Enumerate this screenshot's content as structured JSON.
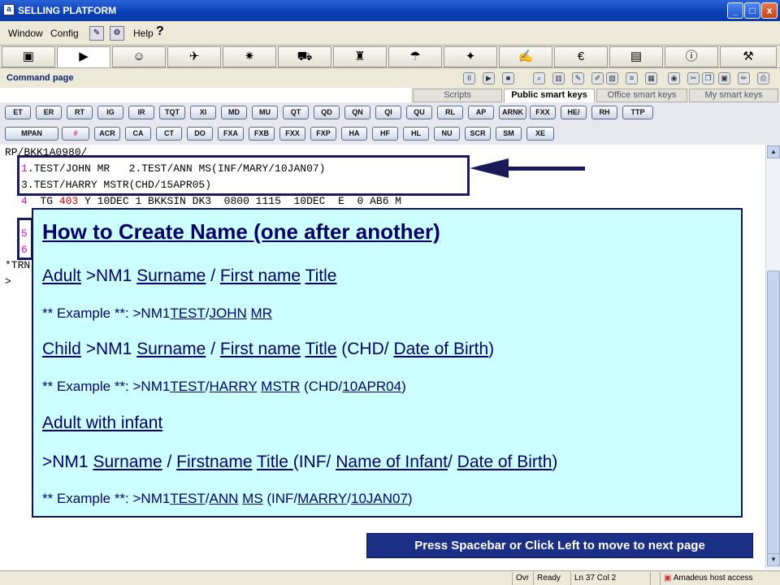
{
  "window": {
    "title": "SELLING PLATFORM",
    "min_label": "_",
    "max_label": "□",
    "close_label": "x"
  },
  "menu": {
    "window": "Window",
    "config": "Config",
    "help": "Help",
    "help_mark": "?"
  },
  "app_icons": [
    "home-icon",
    "terminal-icon",
    "agent-icon",
    "plane-icon",
    "plane-services-icon",
    "car-icon",
    "hotel-icon",
    "insurance-icon",
    "ticket-icon",
    "edit-icon",
    "money-icon",
    "docs-icon",
    "info-icon",
    "tools-icon"
  ],
  "command": {
    "page_label": "Command page"
  },
  "tabs": {
    "scripts": "Scripts",
    "public": "Public smart keys",
    "office": "Office smart keys",
    "my": "My smart keys"
  },
  "keys_row1": [
    "ET",
    "ER",
    "RT",
    "IG",
    "IR",
    "TQT",
    "XI",
    "MD",
    "MU",
    "QT",
    "QD",
    "QN",
    "QI",
    "QU",
    "RL",
    "AP",
    "ARNK",
    "FXX",
    "HE/",
    "RH",
    "TTP"
  ],
  "keys_row2": [
    "MPAN",
    "#",
    "ACR",
    "CA",
    "CT",
    "DO",
    "FXA",
    "FXB",
    "FXX",
    "FXP",
    "HA",
    "HF",
    "HL",
    "NU",
    "SCR",
    "SM",
    "XE"
  ],
  "terminal": {
    "line1": "RP/BKK1A0980/",
    "n1": "1",
    "line2": ".TEST/JOHN MR   2.TEST/ANN MS(INF/MARY/10JAN07)",
    "line3": "3.TEST/HARRY MSTR(CHD/15APR05)",
    "n4": "4",
    "line4a": "  TG ",
    "line4b": "403",
    "line4c": " Y 10DEC 1 BKKSIN DK3  0800 1115  10DEC  E  0 AB6 M",
    "n5": "5",
    "n6": "6",
    "line7": "*TRN",
    "prompt": ">"
  },
  "panel": {
    "title": "How to Create Name (one after another)",
    "adult": {
      "label": "Adult",
      "cmd": " >NM1 ",
      "surname": "Surname",
      "slash": " / ",
      "first": "First name",
      "sp": " ",
      "title": "Title"
    },
    "ex1": {
      "pre": "** Example **: >NM1",
      "a": "TEST",
      "s": "/",
      "b": "JOHN",
      "sp": " ",
      "c": "MR"
    },
    "child": {
      "label": "Child",
      "cmd": " >NM1 ",
      "surname": "Surname",
      "slash": " / ",
      "first": "First name",
      "sp": " ",
      "title": "Title",
      "chd": " (CHD/ ",
      "dob": "Date of Birth",
      "close": ")"
    },
    "ex2": {
      "pre": "** Example **: >NM1",
      "a": "TEST",
      "s": "/",
      "b": "HARRY",
      "sp": " ",
      "c": "MSTR",
      "chd": " (CHD/",
      "d": "10APR04",
      "close": ")"
    },
    "infant": {
      "label": "Adult with infant"
    },
    "inf": {
      "cmd": ">NM1 ",
      "surname": "Surname",
      "slash": " / ",
      "first": "Firstname",
      "sp": " ",
      "title": "Title ",
      "inf": "(INF/ ",
      "name": "Name of Infant",
      "slash2": "/ ",
      "dob": "Date of Birth",
      "close": ")"
    },
    "ex3": {
      "pre": "** Example **: >NM1",
      "a": "TEST",
      "s": "/",
      "b": "ANN",
      "sp": " ",
      "c": "MS",
      "inf": " (INF/",
      "d": "MARRY",
      "s2": "/",
      "e": "10JAN07",
      "close": ")"
    }
  },
  "next_button": "Press Spacebar or Click Left to move to next page",
  "status": {
    "ovr": "Ovr",
    "ready": "Ready",
    "pos": "Ln 37 Col 2",
    "host": "Amadeus host access"
  }
}
